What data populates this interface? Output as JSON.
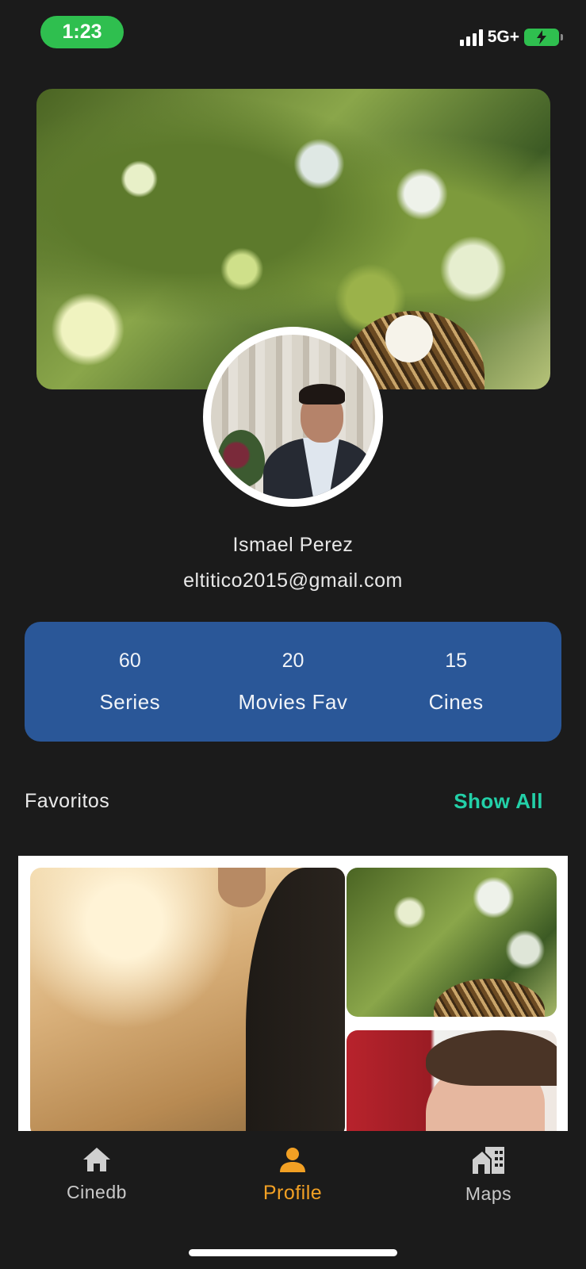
{
  "status_bar": {
    "time": "1:23",
    "network": "5G+"
  },
  "profile": {
    "name": "Ismael Perez",
    "email": "eltitico2015@gmail.com"
  },
  "stats": [
    {
      "value": "60",
      "label": "Series"
    },
    {
      "value": "20",
      "label": "Movies Fav"
    },
    {
      "value": "15",
      "label": "Cines"
    }
  ],
  "favorites": {
    "title": "Favoritos",
    "show_all": "Show All"
  },
  "nav": {
    "items": [
      {
        "label": "Cinedb",
        "icon": "home-icon"
      },
      {
        "label": "Profile",
        "icon": "person-icon"
      },
      {
        "label": "Maps",
        "icon": "city-icon"
      }
    ],
    "active": "Profile"
  },
  "colors": {
    "background": "#1b1b1b",
    "stats_card": "#2a5798",
    "accent_green": "#23d0a8",
    "accent_orange": "#f2a024",
    "time_pill": "#2fbf4f"
  }
}
